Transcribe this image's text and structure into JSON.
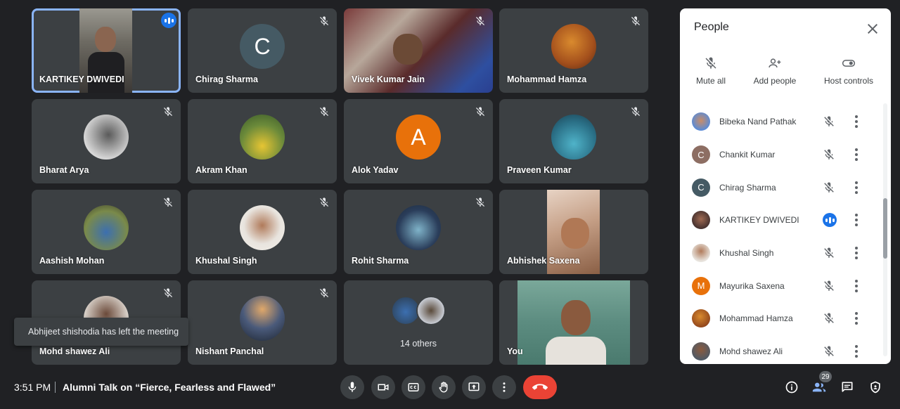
{
  "tiles": [
    {
      "name": "KARTIKEY DWIVEDI",
      "type": "video",
      "speaking": true
    },
    {
      "name": "Chirag Sharma",
      "type": "letter",
      "letter": "C",
      "color": "#455a64"
    },
    {
      "name": "Vivek Kumar Jain",
      "type": "video"
    },
    {
      "name": "Mohammad Hamza",
      "type": "photo"
    },
    {
      "name": "Bharat Arya",
      "type": "photo"
    },
    {
      "name": "Akram Khan",
      "type": "photo"
    },
    {
      "name": "Alok Yadav",
      "type": "letter",
      "letter": "A",
      "color": "#e8710a"
    },
    {
      "name": "Praveen Kumar",
      "type": "photo"
    },
    {
      "name": "Aashish Mohan",
      "type": "photo"
    },
    {
      "name": "Khushal Singh",
      "type": "photo"
    },
    {
      "name": "Rohit Sharma",
      "type": "photo"
    },
    {
      "name": "Abhishek Saxena",
      "type": "video"
    },
    {
      "name": "Mohd shawez Ali",
      "type": "photo"
    },
    {
      "name": "Nishant Panchal",
      "type": "photo"
    },
    {
      "name": "14 others",
      "type": "others"
    },
    {
      "name": "You",
      "type": "video"
    }
  ],
  "toast": "Abhijeet shishodia has left the meeting",
  "panel": {
    "title": "People",
    "actions": {
      "mute_all": "Mute all",
      "add_people": "Add people",
      "host_controls": "Host controls"
    },
    "participants": [
      {
        "name": "Bibeka Nand Pathak",
        "avatar": "photo",
        "color": "#5b8bd6",
        "speaking": false
      },
      {
        "name": "Chankit Kumar",
        "avatar": "letter",
        "letter": "C",
        "color": "#8d6e63",
        "speaking": false
      },
      {
        "name": "Chirag Sharma",
        "avatar": "letter",
        "letter": "C",
        "color": "#455a64",
        "speaking": false
      },
      {
        "name": "KARTIKEY DWIVEDI",
        "avatar": "photo",
        "color": "#6d4c41",
        "speaking": true
      },
      {
        "name": "Khushal Singh",
        "avatar": "photo",
        "color": "#c9a98a",
        "speaking": false
      },
      {
        "name": "Mayurika Saxena",
        "avatar": "letter",
        "letter": "M",
        "color": "#e8710a",
        "speaking": false
      },
      {
        "name": "Mohammad Hamza",
        "avatar": "photo",
        "color": "#bf5b2c",
        "speaking": false
      },
      {
        "name": "Mohd shawez Ali",
        "avatar": "photo",
        "color": "#4a5a6a",
        "speaking": false
      }
    ]
  },
  "bottom": {
    "time": "3:51 PM",
    "separator": "|",
    "meeting_title": "Alumni Talk on “Fierce, Fearless and Flawed”",
    "participant_count": "29"
  }
}
